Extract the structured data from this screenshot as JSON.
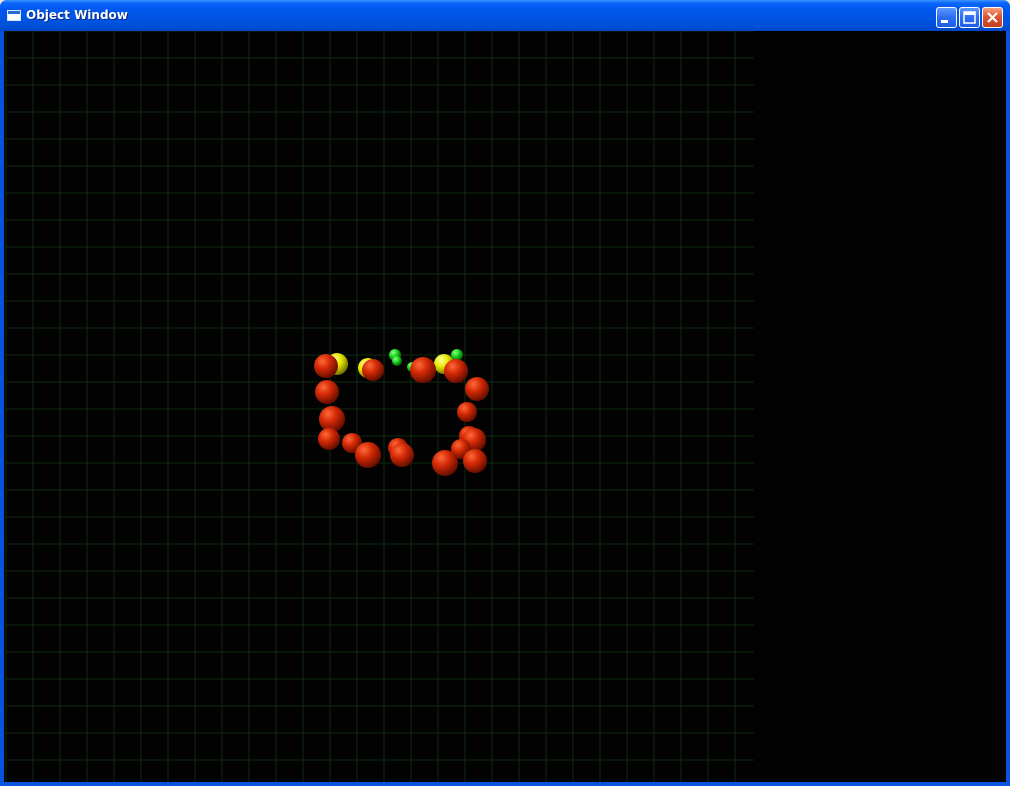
{
  "window": {
    "title": "Object Window",
    "icon": "window-icon"
  },
  "title_buttons": {
    "minimize_icon": "minimize-icon",
    "maximize_icon": "maximize-icon",
    "close_icon": "close-icon"
  },
  "scene": {
    "background_color": "#020202",
    "grid_color": "#0f2a12",
    "sphere_colors": {
      "red": "#c81a00",
      "yellow": "#e6e600",
      "green": "#1ad21a"
    }
  }
}
